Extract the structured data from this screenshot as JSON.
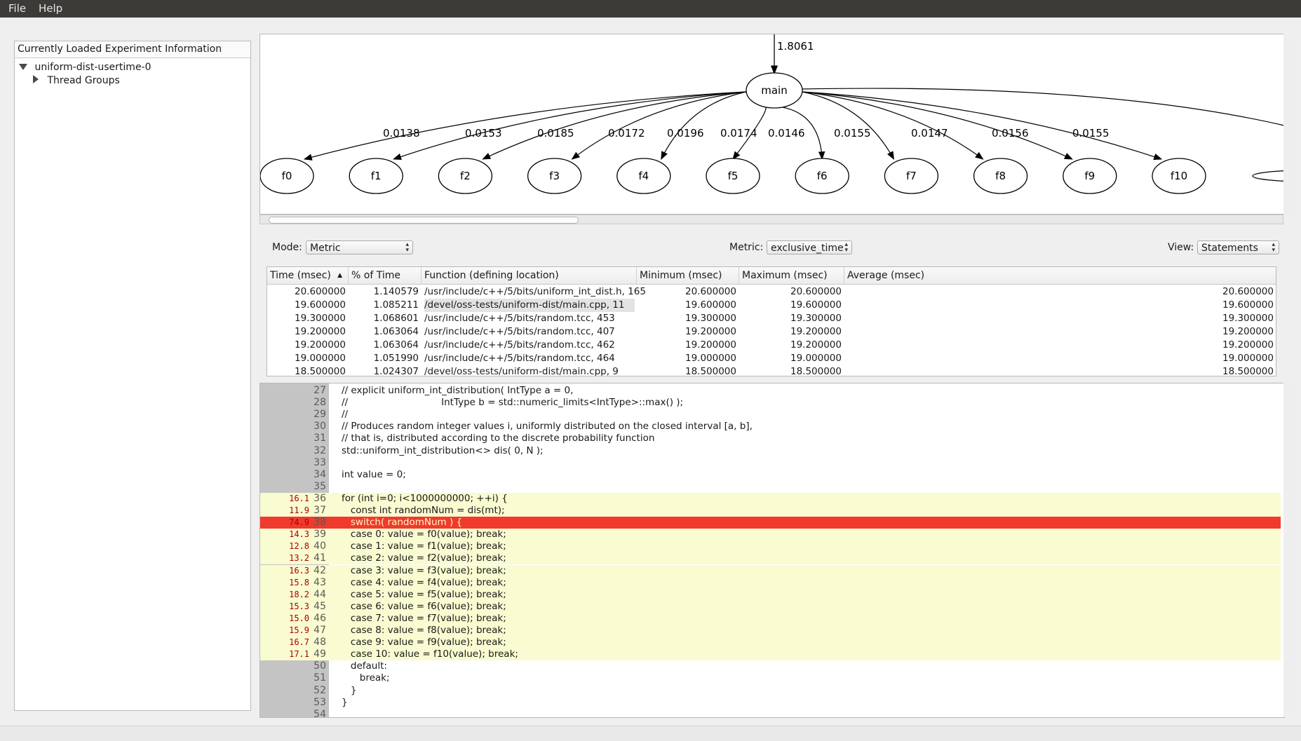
{
  "menu": {
    "file": "File",
    "help": "Help"
  },
  "left_panel": {
    "title": "Currently Loaded Experiment Information",
    "experiment": "uniform-dist-usertime-0",
    "child": "Thread Groups"
  },
  "graph": {
    "root": {
      "label": "main",
      "incoming": "1.8061"
    },
    "nodes": [
      {
        "label": "f0",
        "edge": "0.0138"
      },
      {
        "label": "f1",
        "edge": "0.0153"
      },
      {
        "label": "f2",
        "edge": "0.0185"
      },
      {
        "label": "f3",
        "edge": "0.0172"
      },
      {
        "label": "f4",
        "edge": "0.0196"
      },
      {
        "label": "f5",
        "edge": "0.0174"
      },
      {
        "label": "f6",
        "edge": "0.0146"
      },
      {
        "label": "f7",
        "edge": "0.0155"
      },
      {
        "label": "f8",
        "edge": "0.0147"
      },
      {
        "label": "f9",
        "edge": "0.0156"
      },
      {
        "label": "f10",
        "edge": "0.0155"
      }
    ]
  },
  "controls": {
    "mode_label": "Mode:",
    "mode_value": "Metric",
    "metric_label": "Metric:",
    "metric_value": "exclusive_time",
    "view_label": "View:",
    "view_value": "Statements"
  },
  "table": {
    "columns": [
      "Time (msec)",
      "% of Time",
      "Function (defining location)",
      "Minimum (msec)",
      "Maximum (msec)",
      "Average (msec)"
    ],
    "rows": [
      [
        "20.600000",
        "1.140579",
        "/usr/include/c++/5/bits/uniform_int_dist.h, 165",
        "20.600000",
        "20.600000",
        "20.600000"
      ],
      [
        "19.600000",
        "1.085211",
        "/devel/oss-tests/uniform-dist/main.cpp, 11",
        "19.600000",
        "19.600000",
        "19.600000"
      ],
      [
        "19.300000",
        "1.068601",
        "/usr/include/c++/5/bits/random.tcc, 453",
        "19.300000",
        "19.300000",
        "19.300000"
      ],
      [
        "19.200000",
        "1.063064",
        "/usr/include/c++/5/bits/random.tcc, 407",
        "19.200000",
        "19.200000",
        "19.200000"
      ],
      [
        "19.200000",
        "1.063064",
        "/usr/include/c++/5/bits/random.tcc, 462",
        "19.200000",
        "19.200000",
        "19.200000"
      ],
      [
        "19.000000",
        "1.051990",
        "/usr/include/c++/5/bits/random.tcc, 464",
        "19.000000",
        "19.000000",
        "19.000000"
      ],
      [
        "18.500000",
        "1.024307",
        "/devel/oss-tests/uniform-dist/main.cpp, 9",
        "18.500000",
        "18.500000",
        "18.500000"
      ]
    ]
  },
  "source": {
    "lines": [
      {
        "n": "27",
        "pct": "",
        "code": "// explicit uniform_int_distribution( IntType a = 0,",
        "hl": ""
      },
      {
        "n": "28",
        "pct": "",
        "code": "//                               IntType b = std::numeric_limits<IntType>::max() );",
        "hl": ""
      },
      {
        "n": "29",
        "pct": "",
        "code": "//",
        "hl": ""
      },
      {
        "n": "30",
        "pct": "",
        "code": "// Produces random integer values i, uniformly distributed on the closed interval [a, b],",
        "hl": ""
      },
      {
        "n": "31",
        "pct": "",
        "code": "// that is, distributed according to the discrete probability function",
        "hl": ""
      },
      {
        "n": "32",
        "pct": "",
        "code": "std::uniform_int_distribution<> dis( 0, N );",
        "hl": ""
      },
      {
        "n": "33",
        "pct": "",
        "code": "",
        "hl": ""
      },
      {
        "n": "34",
        "pct": "",
        "code": "int value = 0;",
        "hl": ""
      },
      {
        "n": "35",
        "pct": "",
        "code": "",
        "hl": ""
      },
      {
        "n": "36",
        "pct": "16.1",
        "code": "for (int i=0; i<1000000000; ++i) {",
        "hl": "y"
      },
      {
        "n": "37",
        "pct": "11.9",
        "code": "   const int randomNum = dis(mt);",
        "hl": "y"
      },
      {
        "n": "38",
        "pct": "74.9",
        "code": "   switch( randomNum ) {",
        "hl": "r"
      },
      {
        "n": "39",
        "pct": "14.3",
        "code": "   case 0: value = f0(value); break;",
        "hl": "y"
      },
      {
        "n": "40",
        "pct": "12.8",
        "code": "   case 1: value = f1(value); break;",
        "hl": "y"
      },
      {
        "n": "41",
        "pct": "13.2",
        "code": "   case 2: value = f2(value); break;",
        "hl": "y"
      },
      {
        "n": "42",
        "pct": "16.3",
        "code": "   case 3: value = f3(value); break;",
        "hl": "y"
      },
      {
        "n": "43",
        "pct": "15.8",
        "code": "   case 4: value = f4(value); break;",
        "hl": "y"
      },
      {
        "n": "44",
        "pct": "18.2",
        "code": "   case 5: value = f5(value); break;",
        "hl": "y"
      },
      {
        "n": "45",
        "pct": "15.3",
        "code": "   case 6: value = f6(value); break;",
        "hl": "y"
      },
      {
        "n": "46",
        "pct": "15.0",
        "code": "   case 7: value = f7(value); break;",
        "hl": "y"
      },
      {
        "n": "47",
        "pct": "15.9",
        "code": "   case 8: value = f8(value); break;",
        "hl": "y"
      },
      {
        "n": "48",
        "pct": "16.7",
        "code": "   case 9: value = f9(value); break;",
        "hl": "y"
      },
      {
        "n": "49",
        "pct": "17.1",
        "code": "   case 10: value = f10(value); break;",
        "hl": "y"
      },
      {
        "n": "50",
        "pct": "",
        "code": "   default:",
        "hl": ""
      },
      {
        "n": "51",
        "pct": "",
        "code": "      break;",
        "hl": ""
      },
      {
        "n": "52",
        "pct": "",
        "code": "   }",
        "hl": ""
      },
      {
        "n": "53",
        "pct": "",
        "code": "}",
        "hl": ""
      },
      {
        "n": "54",
        "pct": "",
        "code": "",
        "hl": ""
      }
    ]
  },
  "colors": {
    "hot_line": "#f03a2e",
    "highlight_line": "#f9fbd0",
    "gutter": "#c4c4c4",
    "percent_text": "#b00000"
  }
}
